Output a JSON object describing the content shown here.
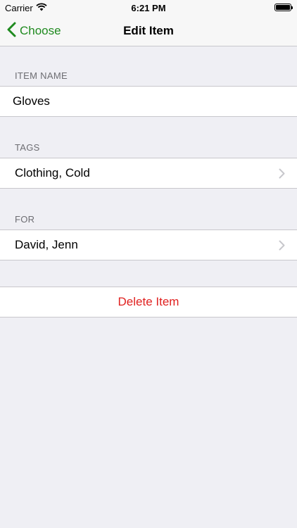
{
  "status_bar": {
    "carrier": "Carrier",
    "time": "6:21 PM",
    "wifi_icon": "wifi-icon",
    "battery_icon": "battery-full-icon"
  },
  "nav": {
    "back_label": "Choose",
    "back_icon": "chevron-left-icon",
    "title": "Edit Item"
  },
  "sections": {
    "item_name": {
      "header": "ITEM NAME",
      "value": "Gloves"
    },
    "tags": {
      "header": "TAGS",
      "value": "Clothing, Cold"
    },
    "for": {
      "header": "FOR",
      "value": "David, Jenn"
    }
  },
  "actions": {
    "delete_label": "Delete Item"
  },
  "colors": {
    "accent": "#1f8a1f",
    "destructive": "#e0201f",
    "background": "#efeff4",
    "header_text": "#6d6d72",
    "separator": "#c8c7cc"
  }
}
